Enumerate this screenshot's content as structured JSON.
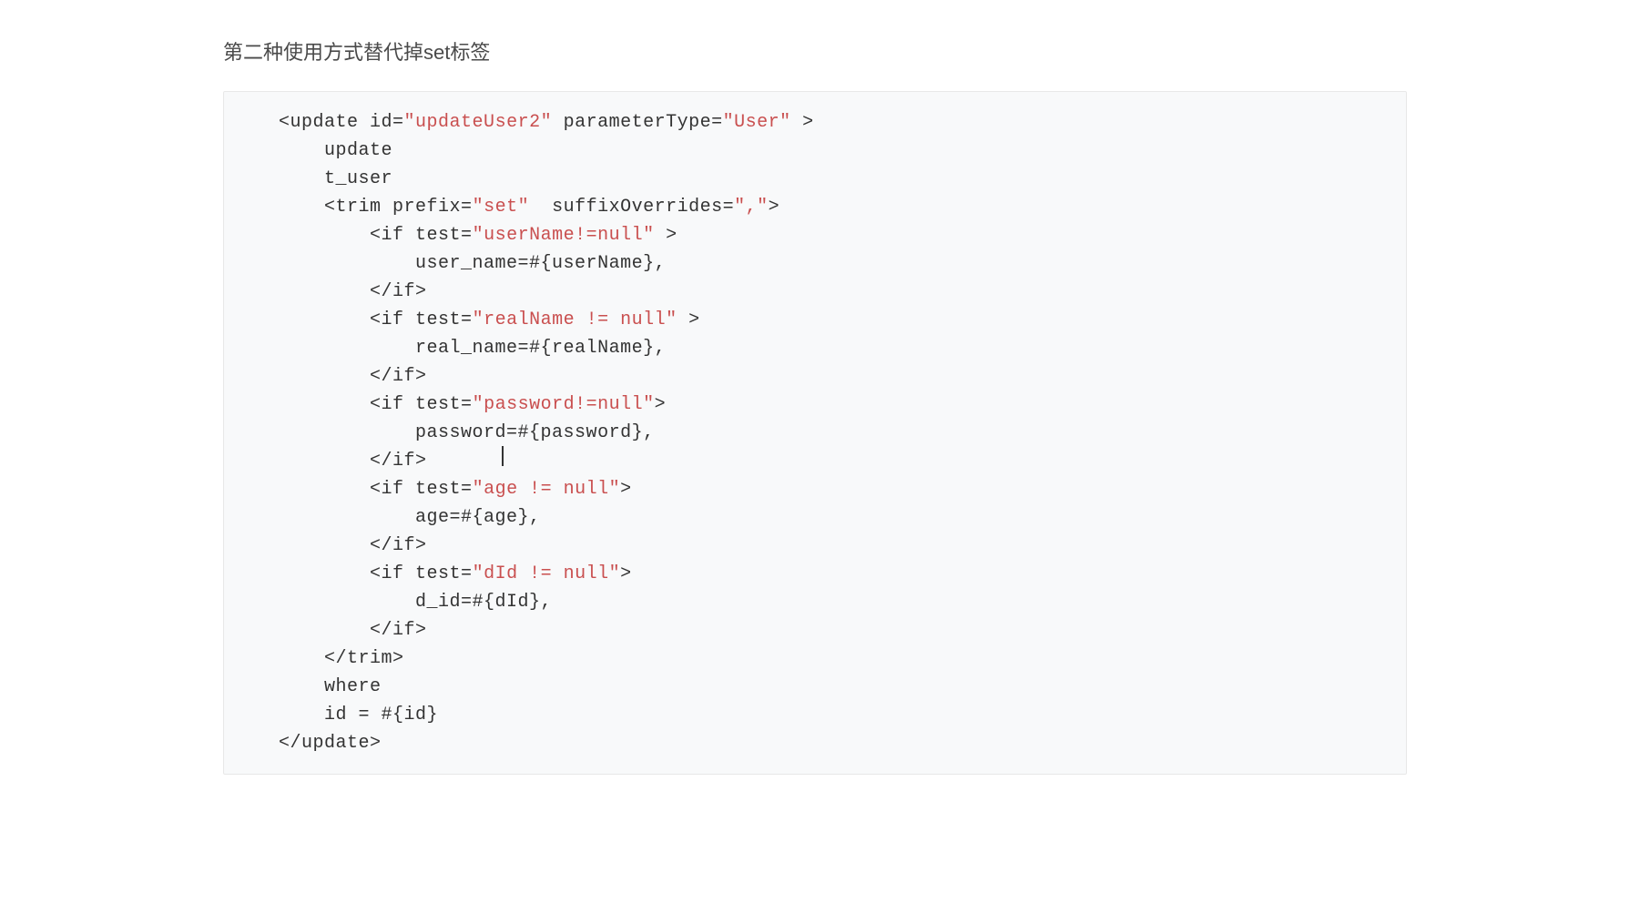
{
  "heading": "第二种使用方式替代掉set标签",
  "code": {
    "colors": {
      "string": "#c94f4f",
      "default": "#333333"
    },
    "lines": [
      {
        "indent": 0,
        "parts": [
          {
            "t": "<update ",
            "c": "default"
          },
          {
            "t": "id",
            "c": "default"
          },
          {
            "t": "=",
            "c": "default"
          },
          {
            "t": "\"updateUser2\"",
            "c": "string"
          },
          {
            "t": " parameterType",
            "c": "default"
          },
          {
            "t": "=",
            "c": "default"
          },
          {
            "t": "\"User\"",
            "c": "string"
          },
          {
            "t": " >",
            "c": "default"
          }
        ]
      },
      {
        "indent": 1,
        "parts": [
          {
            "t": "update",
            "c": "default"
          }
        ]
      },
      {
        "indent": 1,
        "parts": [
          {
            "t": "t_user",
            "c": "default"
          }
        ]
      },
      {
        "indent": 1,
        "parts": [
          {
            "t": "<trim ",
            "c": "default"
          },
          {
            "t": "prefix",
            "c": "default"
          },
          {
            "t": "=",
            "c": "default"
          },
          {
            "t": "\"set\"",
            "c": "string"
          },
          {
            "t": "  suffixOverrides",
            "c": "default"
          },
          {
            "t": "=",
            "c": "default"
          },
          {
            "t": "\",\"",
            "c": "string"
          },
          {
            "t": ">",
            "c": "default"
          }
        ]
      },
      {
        "indent": 2,
        "parts": [
          {
            "t": "<if ",
            "c": "default"
          },
          {
            "t": "test",
            "c": "default"
          },
          {
            "t": "=",
            "c": "default"
          },
          {
            "t": "\"userName!=null\"",
            "c": "string"
          },
          {
            "t": " >",
            "c": "default"
          }
        ]
      },
      {
        "indent": 3,
        "parts": [
          {
            "t": "user_name=#{userName},",
            "c": "default"
          }
        ]
      },
      {
        "indent": 2,
        "parts": [
          {
            "t": "</if>",
            "c": "default"
          }
        ]
      },
      {
        "indent": 2,
        "parts": [
          {
            "t": "<if ",
            "c": "default"
          },
          {
            "t": "test",
            "c": "default"
          },
          {
            "t": "=",
            "c": "default"
          },
          {
            "t": "\"realName != null\"",
            "c": "string"
          },
          {
            "t": " >",
            "c": "default"
          }
        ]
      },
      {
        "indent": 3,
        "parts": [
          {
            "t": "real_name=#{realName},",
            "c": "default"
          }
        ]
      },
      {
        "indent": 2,
        "parts": [
          {
            "t": "</if>",
            "c": "default"
          }
        ]
      },
      {
        "indent": 2,
        "parts": [
          {
            "t": "<if ",
            "c": "default"
          },
          {
            "t": "test",
            "c": "default"
          },
          {
            "t": "=",
            "c": "default"
          },
          {
            "t": "\"password!=null\"",
            "c": "string"
          },
          {
            "t": ">",
            "c": "default"
          }
        ]
      },
      {
        "indent": 3,
        "parts": [
          {
            "t": "password=#{password},",
            "c": "default"
          }
        ]
      },
      {
        "indent": 2,
        "parts": [
          {
            "t": "</if>",
            "c": "default"
          }
        ]
      },
      {
        "indent": 2,
        "parts": [
          {
            "t": "<if ",
            "c": "default"
          },
          {
            "t": "test",
            "c": "default"
          },
          {
            "t": "=",
            "c": "default"
          },
          {
            "t": "\"age != null\"",
            "c": "string"
          },
          {
            "t": ">",
            "c": "default"
          }
        ]
      },
      {
        "indent": 3,
        "parts": [
          {
            "t": "age=#{age},",
            "c": "default"
          }
        ]
      },
      {
        "indent": 2,
        "parts": [
          {
            "t": "</if>",
            "c": "default"
          }
        ]
      },
      {
        "indent": 2,
        "parts": [
          {
            "t": "<if ",
            "c": "default"
          },
          {
            "t": "test",
            "c": "default"
          },
          {
            "t": "=",
            "c": "default"
          },
          {
            "t": "\"dId != null\"",
            "c": "string"
          },
          {
            "t": ">",
            "c": "default"
          }
        ]
      },
      {
        "indent": 3,
        "parts": [
          {
            "t": "d_id=#{dId},",
            "c": "default"
          }
        ]
      },
      {
        "indent": 2,
        "parts": [
          {
            "t": "</if>",
            "c": "default"
          }
        ]
      },
      {
        "indent": 1,
        "parts": [
          {
            "t": "</trim>",
            "c": "default"
          }
        ]
      },
      {
        "indent": 1,
        "parts": [
          {
            "t": "where",
            "c": "default"
          }
        ]
      },
      {
        "indent": 1,
        "parts": [
          {
            "t": "id = #{id}",
            "c": "default"
          }
        ]
      },
      {
        "indent": 0,
        "parts": [
          {
            "t": "</update>",
            "c": "default"
          }
        ]
      }
    ]
  }
}
